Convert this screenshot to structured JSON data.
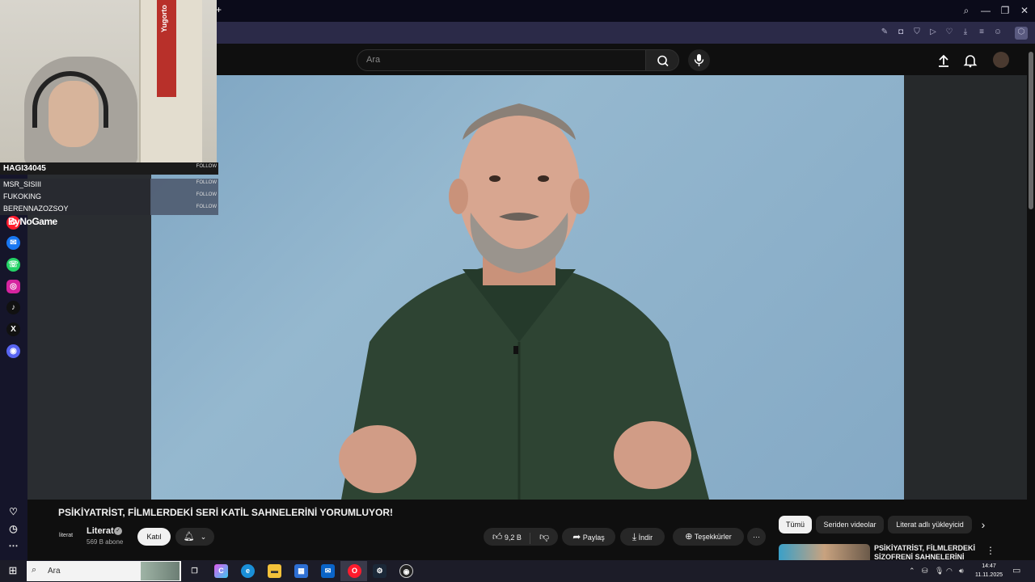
{
  "browser": {
    "window_controls": {
      "search": "⌕",
      "minimize": "—",
      "restore": "❐",
      "close": "✕"
    },
    "new_tab": "+"
  },
  "youtube": {
    "search": {
      "placeholder": "Ara"
    },
    "video": {
      "title": "PSİKİYATRİST, FİLMLERDEKİ SERİ KATİL SAHNELERİNİ YORUMLUYOR!",
      "channel": {
        "name": "Literat",
        "avatar_text": "literat",
        "subscribers": "569 B abone"
      },
      "join_label": "Katıl",
      "like_count": "9,2 B",
      "share_label": "Paylaş",
      "download_label": "İndir",
      "thanks_label": "Teşekkürler"
    },
    "chips": [
      "Tümü",
      "Seriden videolar",
      "Literat adlı yükleyicid"
    ],
    "recommendation": {
      "title": "PSİKİYATRİST, FİLMLERDEKİ SİZOFRENİ SAHNELERİNİ"
    }
  },
  "stream_overlay": {
    "followers": [
      {
        "name": "HAGI34045",
        "action": "FOLLOW"
      },
      {
        "name": "MSR_SISIII",
        "action": "FOLLOW"
      },
      {
        "name": "FUKOKING",
        "action": "FOLLOW"
      },
      {
        "name": "BERENNAZOZSOY",
        "action": "FOLLOW"
      }
    ],
    "watermark": "ByNoGame",
    "door_text": "Yugorto"
  },
  "taskbar": {
    "search_placeholder": "Ara",
    "clock_time": "14:47",
    "clock_date": "11.11.2025"
  },
  "colors": {
    "accent_opera": "#ff1b2d",
    "youtube_bg": "#0f0f0f",
    "chip_active": "#f1f1f1"
  }
}
